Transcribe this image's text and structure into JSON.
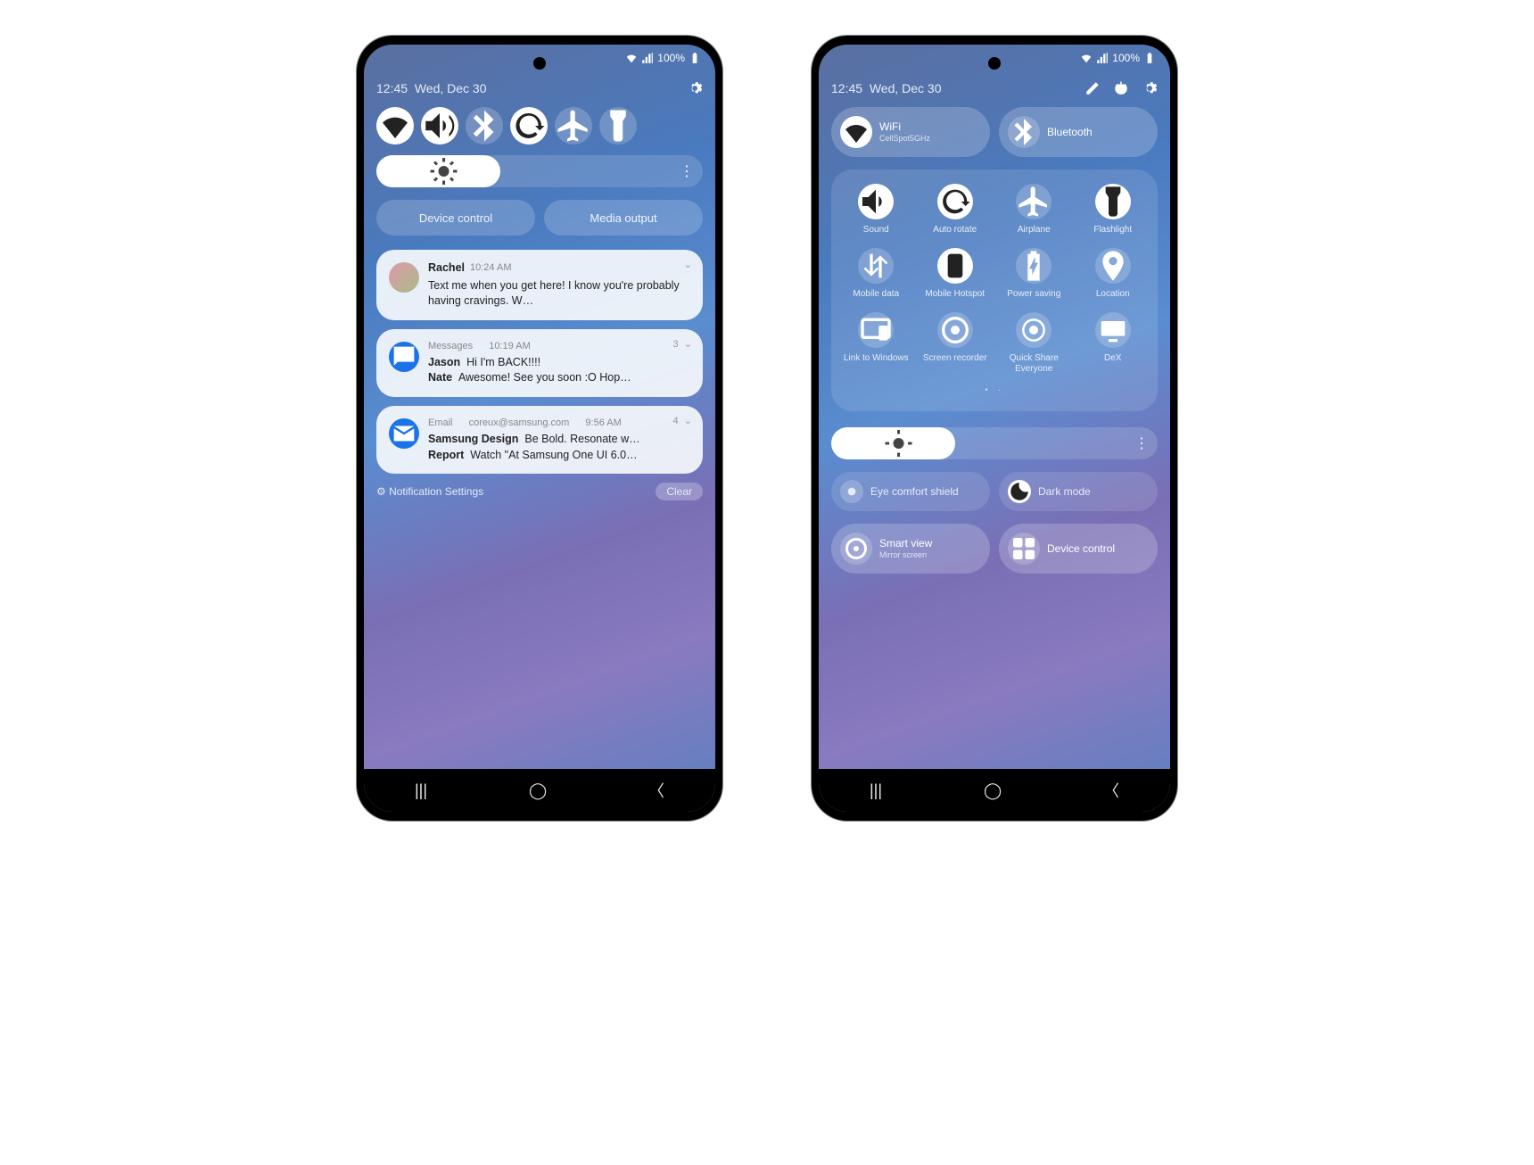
{
  "status": {
    "battery": "100%"
  },
  "header": {
    "time": "12:45",
    "date": "Wed, Dec 30"
  },
  "left": {
    "pills": {
      "device_control": "Device control",
      "media_output": "Media output"
    },
    "notif1": {
      "sender": "Rachel",
      "time": "10:24 AM",
      "msg": "Text me when you get here! I know you're probably having cravings. W…"
    },
    "notif2": {
      "app": "Messages",
      "time": "10:19 AM",
      "count": "3",
      "line1a": "Jason",
      "line1b": "Hi I'm BACK!!!!",
      "line2a": "Nate",
      "line2b": "Awesome! See you soon :O Hop…"
    },
    "notif3": {
      "app": "Email",
      "addr": "coreux@samsung.com",
      "time": "9:56 AM",
      "count": "4",
      "line1a": "Samsung Design",
      "line1b": "Be Bold. Resonate w…",
      "line2a": "Report",
      "line2b": "Watch \"At Samsung One UI 6.0…"
    },
    "settings_link": "Notification Settings",
    "clear": "Clear"
  },
  "right": {
    "wifi": {
      "label": "WiFi",
      "sub": "CellSpot5GHz"
    },
    "bluetooth": {
      "label": "Bluetooth"
    },
    "tiles": {
      "sound": "Sound",
      "auto_rotate": "Auto rotate",
      "airplane": "Airplane",
      "flashlight": "Flashlight",
      "mobile_data": "Mobile data",
      "mobile_hotspot": "Mobile Hotspot",
      "power_saving": "Power saving",
      "location": "Location",
      "link_windows": "Link to Windows",
      "screen_recorder": "Screen recorder",
      "quick_share": "Quick Share Everyone",
      "dex": "DeX"
    },
    "eye_comfort": "Eye comfort shield",
    "dark_mode": "Dark mode",
    "smart_view": {
      "label": "Smart view",
      "sub": "Mirror screen"
    },
    "device_control": "Device control"
  }
}
